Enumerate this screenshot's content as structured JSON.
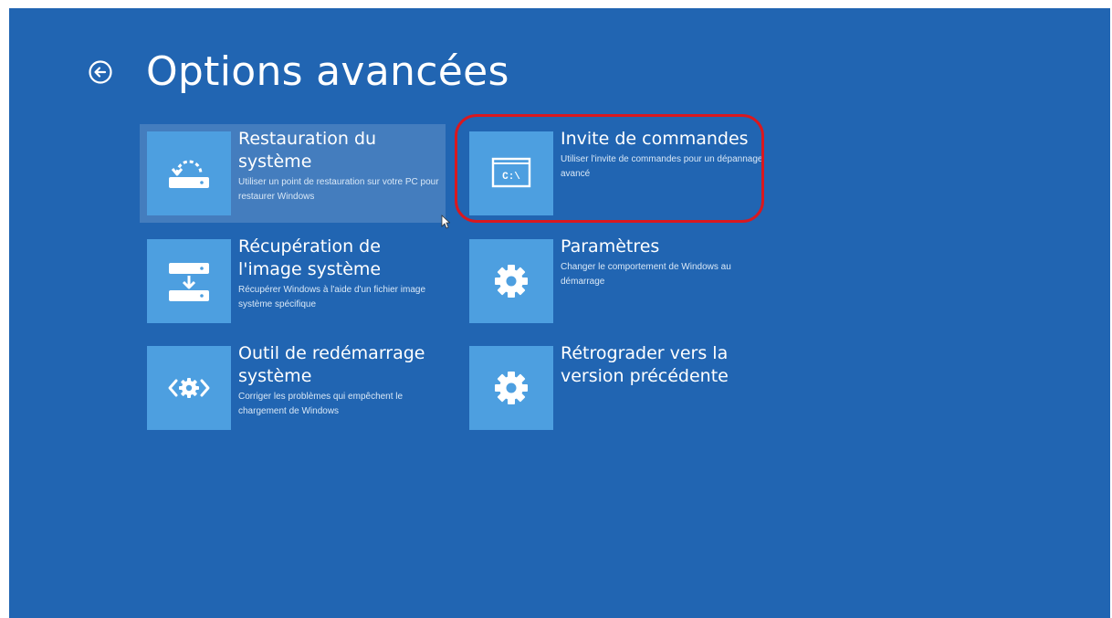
{
  "header": {
    "back_icon": "back-arrow-circle-icon",
    "title": "Options avancées"
  },
  "tiles": [
    {
      "title": "Restauration du système",
      "description": "Utiliser un point de restauration sur votre PC pour restaurer Windows",
      "icon": "system-restore-icon",
      "selected": true
    },
    {
      "title": "Invite de commandes",
      "description": "Utiliser l'invite de commandes pour un dépannage avancé",
      "icon": "command-prompt-icon",
      "icon_text": "C:\\"
    },
    {
      "title": "Récupération de l'image système",
      "description": "Récupérer Windows à l'aide d'un fichier image système spécifique",
      "icon": "system-image-recovery-icon"
    },
    {
      "title": "Paramètres",
      "description": "Changer le comportement de Windows au démarrage",
      "icon": "gear-icon"
    },
    {
      "title": "Outil de redémarrage système",
      "description": "Corriger les problèmes qui empêchent le chargement de Windows",
      "icon": "startup-repair-icon"
    },
    {
      "title": "Rétrograder vers la version précédente",
      "description": "",
      "icon": "gear-icon"
    }
  ],
  "colors": {
    "background": "#2165b2",
    "tile_icon_bg": "#4d9fe0",
    "highlight": "#d9181f"
  }
}
